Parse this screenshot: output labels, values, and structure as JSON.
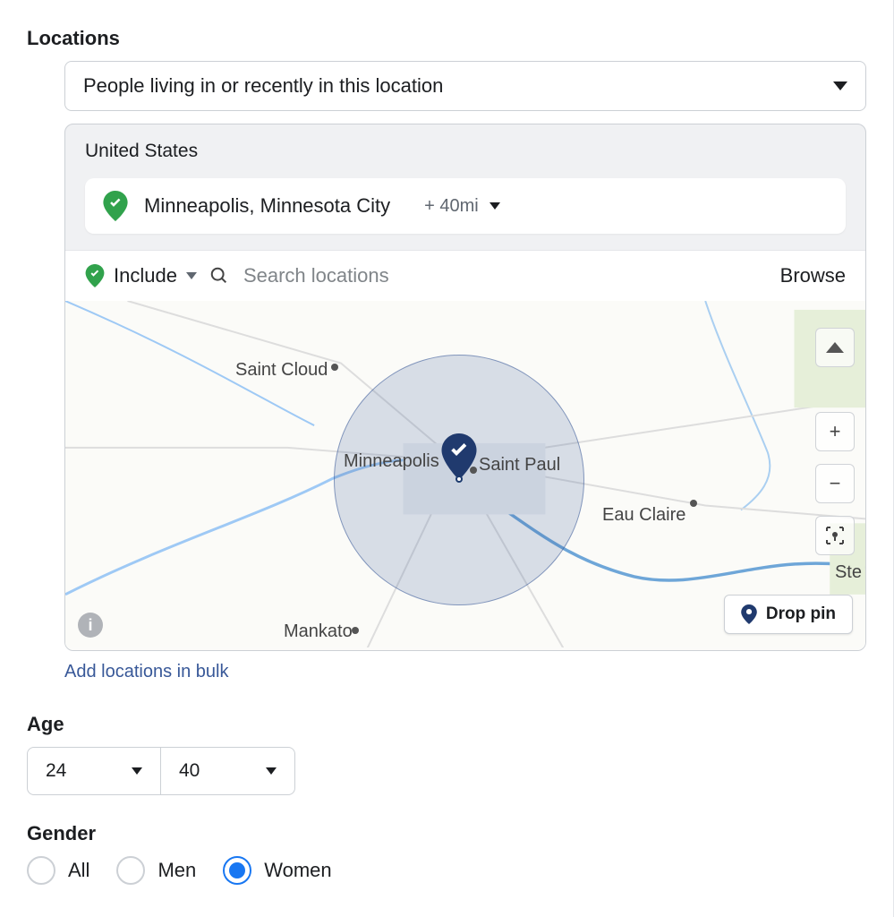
{
  "locations": {
    "label": "Locations",
    "targeting_dropdown": "People living in or recently in this location",
    "country": "United States",
    "chip_city": "Minneapolis, Minnesota City",
    "chip_radius": "+ 40mi",
    "include_label": "Include",
    "search_placeholder": "Search locations",
    "browse": "Browse",
    "bulk_link": "Add locations in bulk",
    "drop_pin": "Drop pin",
    "map_cities": {
      "saint_cloud": "Saint Cloud",
      "minneapolis": "Minneapolis",
      "saint_paul": "Saint Paul",
      "eau_claire": "Eau Claire",
      "mankato": "Mankato",
      "ste": "Ste"
    }
  },
  "age": {
    "label": "Age",
    "min": "24",
    "max": "40"
  },
  "gender": {
    "label": "Gender",
    "options": {
      "all": "All",
      "men": "Men",
      "women": "Women"
    },
    "selected": "women"
  }
}
